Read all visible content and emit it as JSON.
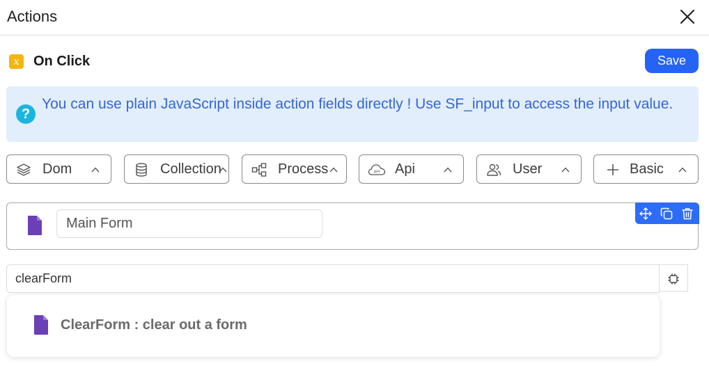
{
  "header": {
    "title": "Actions",
    "close_icon": "close-icon"
  },
  "event": {
    "icon_glyph": "x",
    "label": "On Click",
    "save_label": "Save"
  },
  "info": {
    "icon_glyph": "?",
    "text": "You can use plain JavaScript inside action fields directly ! Use SF_input to access the input value."
  },
  "categories": [
    {
      "label": "Dom",
      "icon": "layers-icon"
    },
    {
      "label": "Collection",
      "icon": "database-icon"
    },
    {
      "label": "Process",
      "icon": "flow-icon"
    },
    {
      "label": "Api",
      "icon": "cloud-api-icon"
    },
    {
      "label": "User",
      "icon": "users-icon"
    },
    {
      "label": "Basic",
      "icon": "plus-icon"
    }
  ],
  "api_icon_text": "API",
  "form_block": {
    "value": "Main Form",
    "tools": [
      "move-icon",
      "duplicate-icon",
      "trash-icon"
    ]
  },
  "command": {
    "value": "clearForm",
    "chip_icon": "chip-icon"
  },
  "suggestions": [
    {
      "text": "ClearForm : clear out a form"
    }
  ],
  "colors": {
    "accent": "#2563f5",
    "info_bg": "#e2eefb",
    "info_text": "#3566d6",
    "event_icon": "#f5b50f",
    "doc_icon": "#6b3fb5"
  }
}
